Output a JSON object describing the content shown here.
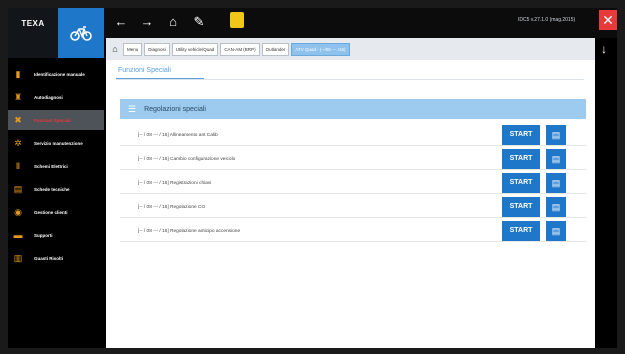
{
  "app": {
    "logo_text": "TEXA",
    "version_text": "IDC5 v.27.1.0 (mag.2015)"
  },
  "topbar": {
    "nav_icons": [
      "←",
      "→",
      "⌂",
      "✎"
    ],
    "close_glyph": "✕",
    "down_glyph": "↓",
    "bike_glyph": "🚲"
  },
  "breadcrumb": {
    "home_glyph": "⌂",
    "items": [
      {
        "label": "Menu",
        "active": false
      },
      {
        "label": "Diagnosi",
        "active": false
      },
      {
        "label": "Utility vehicle/Quad",
        "active": false
      },
      {
        "label": "CAN-AM (BRP)",
        "active": false
      },
      {
        "label": "Outlander",
        "active": false
      },
      {
        "label": "ATV Quad - (--/08 --- /16)",
        "active": true
      }
    ]
  },
  "sidebar": {
    "items": [
      {
        "icon": "▮",
        "label": "Identificazione manuale",
        "active": false
      },
      {
        "icon": "♜",
        "label": "Autodiagnosi",
        "active": false
      },
      {
        "icon": "✖",
        "label": "Funzioni Speciali",
        "active": true
      },
      {
        "icon": "✲",
        "label": "Servizio manutenzione",
        "active": false
      },
      {
        "icon": "Ⅱ",
        "label": "Schemi Elettrici",
        "active": false
      },
      {
        "icon": "▤",
        "label": "Schede tecniche",
        "active": false
      },
      {
        "icon": "◉",
        "label": "Gestione clienti",
        "active": false
      },
      {
        "icon": "▬",
        "label": "Supporti",
        "active": false
      },
      {
        "icon": "▥",
        "label": "Guasti Risolti",
        "active": false
      }
    ]
  },
  "main": {
    "tab_label": "Funzioni Speciali",
    "section": {
      "icon": "☰",
      "title": "Regolazioni speciali"
    },
    "rows": [
      {
        "text": "[-- / 08 --- / 16]   Allineamento ant Calib",
        "start_label": "START",
        "doc_glyph": "▤"
      },
      {
        "text": "[-- / 08 --- / 16]   Cambio configurazione veicolo",
        "start_label": "START",
        "doc_glyph": "▤"
      },
      {
        "text": "[-- / 08 --- / 16]   Registrazioni chiavi",
        "start_label": "START",
        "doc_glyph": "▤"
      },
      {
        "text": "[-- / 08 --- / 16]   Regolazione CO",
        "start_label": "START",
        "doc_glyph": "▤"
      },
      {
        "text": "[-- / 08 --- / 16]   Regolazione anticipo accensione",
        "start_label": "START",
        "doc_glyph": "▤"
      }
    ]
  },
  "colors": {
    "accent_blue": "#1f77c9",
    "section_blue": "#9ccbef",
    "active_red": "#e8373a",
    "icon_orange": "#e49a1c",
    "yellow": "#f2c617"
  }
}
